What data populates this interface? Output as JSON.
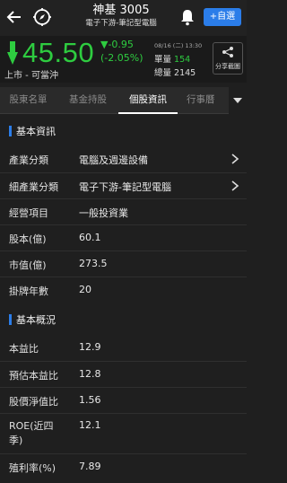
{
  "header": {
    "title": "神基 3005",
    "subtitle": "電子下游-筆記型電腦",
    "add_label": "+自選"
  },
  "quote": {
    "price": "45.50",
    "change": "▼-0.95",
    "change_pct": "(-2.05%)",
    "market": "上市 - 可當沖",
    "date": "08/16 (二) 13:30",
    "single_vol_label": "單量",
    "single_vol": "154",
    "total_vol_label": "總量",
    "total_vol": "2145",
    "share_label": "分享截圖",
    "colors": {
      "down": "#2ecc40",
      "accent": "#2b7de9"
    }
  },
  "tabs": [
    "股東名單",
    "基金持股",
    "個股資訊",
    "行事曆"
  ],
  "sections": {
    "basic_info_title": "基本資訊",
    "basic_overview_title": "基本概況"
  },
  "basic_info": [
    {
      "label": "產業分類",
      "value": "電腦及週邊設備"
    },
    {
      "label": "細產業分類",
      "value": "電子下游-筆記型電腦"
    },
    {
      "label": "經營項目",
      "value": "一般投資業"
    },
    {
      "label": "股本(億)",
      "value": "60.1"
    },
    {
      "label": "市值(億)",
      "value": "273.5"
    },
    {
      "label": "掛牌年數",
      "value": "20"
    }
  ],
  "overview": [
    {
      "label": "本益比",
      "value": "12.9"
    },
    {
      "label": "預估本益比",
      "value": "12.8"
    },
    {
      "label": "股價淨值比",
      "value": "1.56"
    },
    {
      "label": "ROE(近四季)",
      "value": "12.1"
    },
    {
      "label": "殖利率(%)",
      "value": "7.89"
    }
  ]
}
